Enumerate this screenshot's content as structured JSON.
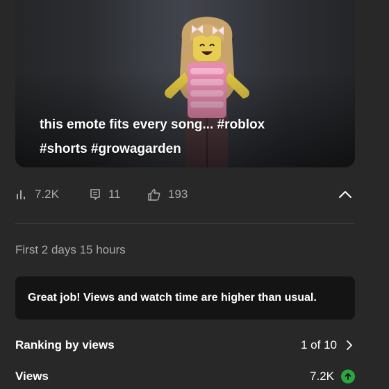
{
  "video": {
    "title_line1": "this emote fits every song... #roblox",
    "title_line2": "#shorts #growagarden"
  },
  "stats": {
    "views": "7.2K",
    "comments": "11",
    "likes": "193"
  },
  "period": "First 2 days 15 hours",
  "insight": "Great job! Views and watch time are higher than usual.",
  "ranking": {
    "label": "Ranking by views",
    "value": "1 of 10"
  },
  "views_metric": {
    "label": "Views",
    "value": "7.2K"
  },
  "colors": {
    "background": "#282828",
    "insight_bg": "#141414",
    "muted_text": "#aaaaaa",
    "trend_up": "#2ba640"
  }
}
